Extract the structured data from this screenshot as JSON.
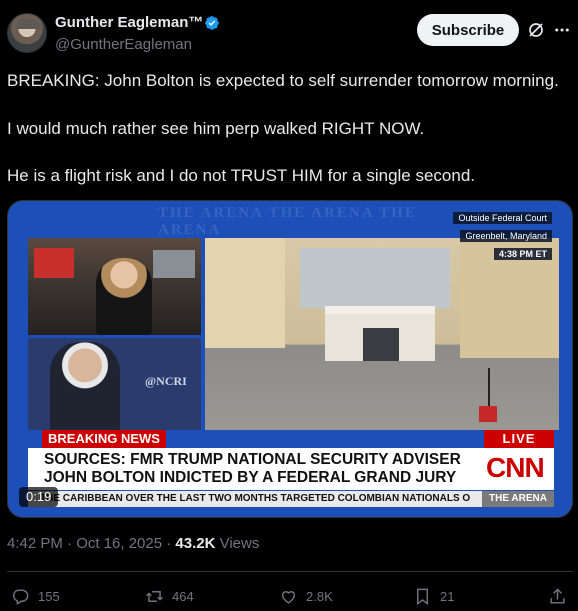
{
  "author": {
    "name": "Gunther Eagleman™",
    "handle": "@GuntherEagleman"
  },
  "header": {
    "subscribe_label": "Subscribe"
  },
  "post": {
    "line1": "BREAKING: John Bolton is expected to self surrender tomorrow morning.",
    "line2": "I would much rather see him perp walked RIGHT NOW.",
    "line3": "He is a flight risk and I do not TRUST HIM for a single second."
  },
  "video": {
    "background_text": "THE ARENA     THE ARENA     THE ARENA",
    "location_line1": "Outside Federal Court",
    "location_line2": "Greenbelt, Maryland",
    "location_time": "4:38 PM ET",
    "inset_logo": "@NCRI",
    "breaking_label": "BREAKING NEWS",
    "live_label": "LIVE",
    "headline_line1": "SOURCES: FMR TRUMP NATIONAL SECURITY ADVISER",
    "headline_line2": "JOHN BOLTON INDICTED BY A FEDERAL GRAND JURY",
    "network_logo": "CNN",
    "ticker": "THE CARIBBEAN OVER THE LAST TWO MONTHS TARGETED COLOMBIAN NATIONALS O",
    "show_name": "THE ARENA",
    "duration": "0:19"
  },
  "meta": {
    "timestamp": "4:42 PM · Oct 16, 2025 · ",
    "views_count": "43.2K",
    "views_label": " Views"
  },
  "actions": {
    "replies": "155",
    "reposts": "464",
    "likes": "2.8K",
    "bookmarks": "21"
  },
  "colors": {
    "background": "#000000",
    "text": "#e7e9ea",
    "muted": "#71767b",
    "verified": "#1d9bf0",
    "cnn_red": "#cc0000"
  }
}
